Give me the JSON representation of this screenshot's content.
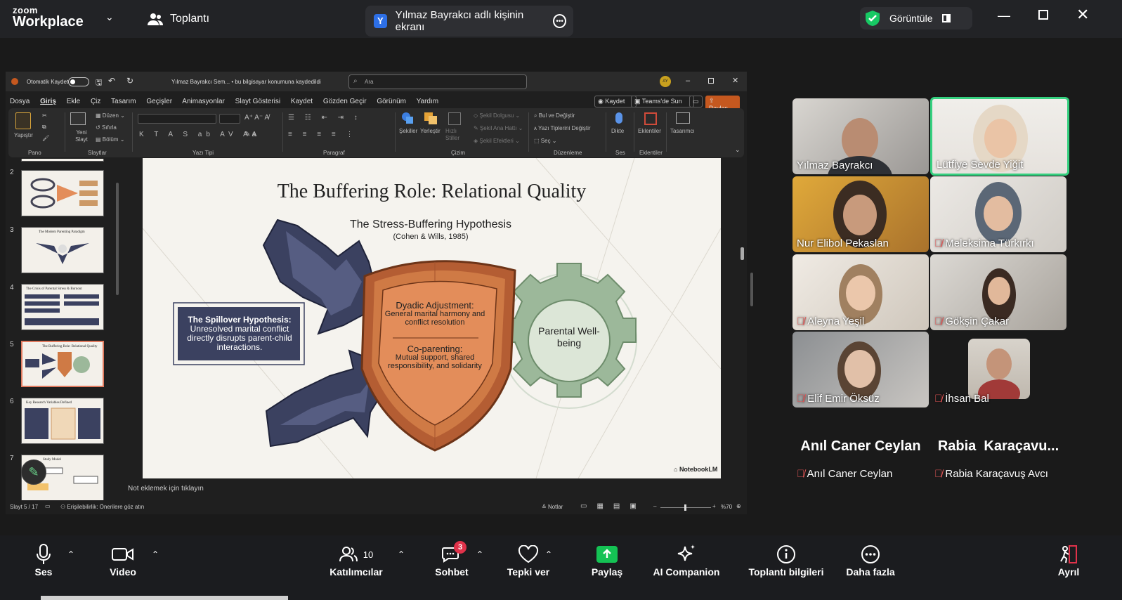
{
  "zoom": {
    "logo_top": "zoom",
    "logo_bottom": "Workplace",
    "meeting_tab": "Toplantı",
    "share_tab_label": "Yılmaz Bayrakcı adlı kişinin ekranı",
    "share_tab_avatar": "Y",
    "view_label": "Görüntüle"
  },
  "ppt": {
    "autosave": "Otomatik Kaydet",
    "doc_title": "Yılmaz Bayrakcı Sem... • bu bilgisayar konumuna kaydedildi",
    "search_placeholder": "Ara",
    "user_initials": "AY",
    "menu": [
      "Dosya",
      "Giriş",
      "Ekle",
      "Çiz",
      "Tasarım",
      "Geçişler",
      "Animasyonlar",
      "Slayt Gösterisi",
      "Kaydet",
      "Gözden Geçir",
      "Görünüm",
      "Yardım"
    ],
    "btn_kaydet": "Kaydet",
    "btn_teams": "Teams'de Sun",
    "btn_paylas": "Paylaş",
    "ribbon": {
      "yapistir": "Yapıştır",
      "pano": "Pano",
      "yeni_slayt": "Yeni Slayt",
      "duzen": "Düzen",
      "sifirla": "Sıfırla",
      "bolum": "Bölüm",
      "slaytlar": "Slaytlar",
      "yazi_tipi": "Yazı Tipi",
      "paragraf": "Paragraf",
      "sekiller": "Şekiller",
      "yerlestir": "Yerleştir",
      "hizli_stiller": "Hızlı Stiller",
      "sekil_dolgusu": "Şekil Dolgusu",
      "sekil_ana_hatti": "Şekil Ana Hattı",
      "sekil_efektleri": "Şekil Efektleri",
      "cizim": "Çizim",
      "bul": "Bul ve Değiştir",
      "yazi_tipleri_degistir": "Yazı Tiplerini Değiştir",
      "sec": "Seç",
      "duzenleme": "Düzenleme",
      "dikte": "Dikte",
      "ses": "Ses",
      "eklentiler": "Eklentiler",
      "tasarimci": "Tasarımcı"
    },
    "thumbs": [
      {
        "num": "2",
        "title": ""
      },
      {
        "num": "3",
        "title": "The Modern Parenting Paradigm"
      },
      {
        "num": "4",
        "title": "The Crisis of Parental Stress & Burnout"
      },
      {
        "num": "5",
        "title": "The Buffering Role: Relational Quality"
      },
      {
        "num": "6",
        "title": "Key Research Variables Defined"
      },
      {
        "num": "7",
        "title": "Study Model"
      }
    ],
    "note_placeholder": "Not eklemek için tıklayın",
    "status_slide": "Slayt 5 / 17",
    "status_access": "Erişilebilirlik: Önerilere göz atın",
    "status_notes": "Notlar",
    "status_zoom": "%70"
  },
  "slide": {
    "title": "The Buffering Role: Relational Quality",
    "subtitle": "The Stress-Buffering Hypothesis",
    "citation": "(Cohen & Wills, 1985)",
    "spill_title": "The Spillover Hypothesis:",
    "spill_body": "Unresolved marital conflict directly disrupts parent-child interactions.",
    "dyadic_title": "Dyadic Adjustment:",
    "dyadic_body": "General marital harmony and conflict resolution",
    "coparent_title": "Co-parenting:",
    "coparent_body": "Mutual support, shared responsibility, and solidarity",
    "gear_label": "Parental Well-being",
    "brand": "NotebookLM"
  },
  "participants": [
    {
      "name": "Yılmaz Bayrakcı",
      "muted": false
    },
    {
      "name": "Lütfiye Sevde Yiğit",
      "muted": false
    },
    {
      "name": "Nur Elibol Pekaslan",
      "muted": false
    },
    {
      "name": "Meleksima Türkırkı",
      "muted": true
    },
    {
      "name": "Aleyna Yeşil",
      "muted": true
    },
    {
      "name": "Gökşin Çakar",
      "muted": true
    },
    {
      "name": "Elif Emir Öksüz",
      "muted": true
    },
    {
      "name": "İhsan Bal",
      "muted": true
    }
  ],
  "no_video": [
    {
      "big": "Anıl Caner Ceylan",
      "small": "Anıl Caner Ceylan"
    },
    {
      "big": "Rabia  Karaçavu...",
      "small": "Rabia Karaçavuş Avcı"
    }
  ],
  "controls": {
    "ses": "Ses",
    "video": "Video",
    "katilimcilar": "Katılımcılar",
    "katilimci_count": "10",
    "sohbet": "Sohbet",
    "sohbet_badge": "3",
    "tepki": "Tepki ver",
    "paylas": "Paylaş",
    "ai": "AI Companion",
    "bilgi": "Toplantı bilgileri",
    "daha": "Daha fazla",
    "ayril": "Ayrıl"
  },
  "colors": {
    "paylas_green": "#14c254",
    "active_speaker": "#35d07f",
    "ppt_accent": "#c5581f",
    "shield_orange": "#cf7a45",
    "arrow_navy": "#3b4160",
    "gear_green": "#9cb89a"
  }
}
